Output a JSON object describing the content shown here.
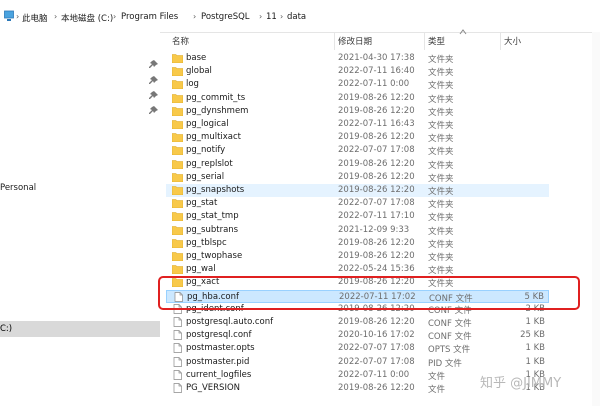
{
  "breadcrumb": [
    "此电脑",
    "本地磁盘 (C:)",
    "Program Files",
    "PostgreSQL",
    "11",
    "data"
  ],
  "navpane": {
    "personal_label": "Personal",
    "drive_label": "C:)"
  },
  "columns": {
    "name": "名称",
    "date": "修改日期",
    "type": "类型",
    "size": "大小"
  },
  "files": [
    {
      "name": "base",
      "date": "2021-04-30 17:38",
      "type": "文件夹",
      "size": "",
      "kind": "folder"
    },
    {
      "name": "global",
      "date": "2022-07-11 16:40",
      "type": "文件夹",
      "size": "",
      "kind": "folder"
    },
    {
      "name": "log",
      "date": "2022-07-11 0:00",
      "type": "文件夹",
      "size": "",
      "kind": "folder"
    },
    {
      "name": "pg_commit_ts",
      "date": "2019-08-26 12:20",
      "type": "文件夹",
      "size": "",
      "kind": "folder"
    },
    {
      "name": "pg_dynshmem",
      "date": "2019-08-26 12:20",
      "type": "文件夹",
      "size": "",
      "kind": "folder"
    },
    {
      "name": "pg_logical",
      "date": "2022-07-11 16:43",
      "type": "文件夹",
      "size": "",
      "kind": "folder"
    },
    {
      "name": "pg_multixact",
      "date": "2019-08-26 12:20",
      "type": "文件夹",
      "size": "",
      "kind": "folder"
    },
    {
      "name": "pg_notify",
      "date": "2022-07-07 17:08",
      "type": "文件夹",
      "size": "",
      "kind": "folder"
    },
    {
      "name": "pg_replslot",
      "date": "2019-08-26 12:20",
      "type": "文件夹",
      "size": "",
      "kind": "folder"
    },
    {
      "name": "pg_serial",
      "date": "2019-08-26 12:20",
      "type": "文件夹",
      "size": "",
      "kind": "folder"
    },
    {
      "name": "pg_snapshots",
      "date": "2019-08-26 12:20",
      "type": "文件夹",
      "size": "",
      "kind": "folder"
    },
    {
      "name": "pg_stat",
      "date": "2022-07-07 17:08",
      "type": "文件夹",
      "size": "",
      "kind": "folder"
    },
    {
      "name": "pg_stat_tmp",
      "date": "2022-07-11 17:10",
      "type": "文件夹",
      "size": "",
      "kind": "folder"
    },
    {
      "name": "pg_subtrans",
      "date": "2021-12-09 9:33",
      "type": "文件夹",
      "size": "",
      "kind": "folder"
    },
    {
      "name": "pg_tblspc",
      "date": "2019-08-26 12:20",
      "type": "文件夹",
      "size": "",
      "kind": "folder"
    },
    {
      "name": "pg_twophase",
      "date": "2019-08-26 12:20",
      "type": "文件夹",
      "size": "",
      "kind": "folder"
    },
    {
      "name": "pg_wal",
      "date": "2022-05-24 15:36",
      "type": "文件夹",
      "size": "",
      "kind": "folder"
    },
    {
      "name": "pg_xact",
      "date": "2019-08-26 12:20",
      "type": "文件夹",
      "size": "",
      "kind": "folder"
    },
    {
      "name": "pg_hba.conf",
      "date": "2022-07-11 17:02",
      "type": "CONF 文件",
      "size": "5 KB",
      "kind": "file"
    },
    {
      "name": "pg_ident.conf",
      "date": "2019-08-26 12:20",
      "type": "CONF 文件",
      "size": "2 KB",
      "kind": "file"
    },
    {
      "name": "postgresql.auto.conf",
      "date": "2019-08-26 12:20",
      "type": "CONF 文件",
      "size": "1 KB",
      "kind": "file"
    },
    {
      "name": "postgresql.conf",
      "date": "2020-10-16 17:02",
      "type": "CONF 文件",
      "size": "25 KB",
      "kind": "file"
    },
    {
      "name": "postmaster.opts",
      "date": "2022-07-07 17:08",
      "type": "OPTS 文件",
      "size": "1 KB",
      "kind": "file"
    },
    {
      "name": "postmaster.pid",
      "date": "2022-07-07 17:08",
      "type": "PID 文件",
      "size": "1 KB",
      "kind": "file"
    },
    {
      "name": "current_logfiles",
      "date": "2022-07-11 0:00",
      "type": "文件",
      "size": "1 KB",
      "kind": "file"
    },
    {
      "name": "PG_VERSION",
      "date": "2019-08-26 12:20",
      "type": "文件",
      "size": "1 KB",
      "kind": "file"
    }
  ],
  "hover_row": "pg_snapshots",
  "selected_row": "pg_hba.conf",
  "watermark": "知乎 @JIMMY",
  "colors": {
    "folder": "#f8c94a",
    "selection": "#cce8ff",
    "hover": "#e5f3ff",
    "highlight_box": "#e02020"
  },
  "icons": {
    "folder": "folder-icon",
    "file": "file-icon",
    "pin": "pin-icon",
    "drive": "drive-icon",
    "chevron": "chevron-right-icon"
  }
}
